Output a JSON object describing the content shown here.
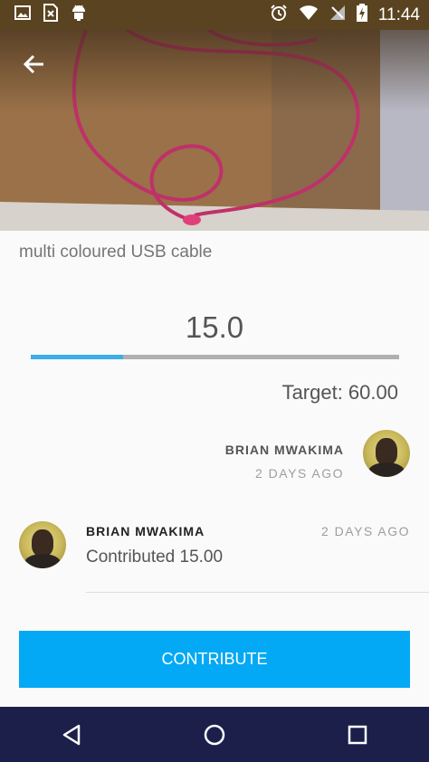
{
  "status_bar": {
    "time": "11:44",
    "left_icons": [
      "image-icon",
      "sim-error-icon",
      "android-icon"
    ],
    "right_icons": [
      "alarm-icon",
      "wifi-icon",
      "no-signal-icon",
      "battery-charging-icon"
    ]
  },
  "hero": {
    "back_icon": "arrow-left-icon",
    "image_subject": "usb-cable-photo"
  },
  "item": {
    "title": "multi coloured USB cable",
    "amount": "15.0",
    "progress_fraction": 0.25,
    "target": "Target: 60.00"
  },
  "owner": {
    "name": "BRIAN MWAKIMA",
    "date": "2 DAYS AGO"
  },
  "contribution": {
    "name": "BRIAN MWAKIMA",
    "date": "2 DAYS AGO",
    "text": "Contributed 15.00"
  },
  "actions": {
    "contribute_label": "CONTRIBUTE"
  },
  "colors": {
    "accent": "#03a9f4",
    "progress": "#3daee9",
    "navbar": "#1b1f4a",
    "statusbar": "#5a4320"
  },
  "nav": [
    "back-nav-icon",
    "home-nav-icon",
    "recents-nav-icon"
  ]
}
